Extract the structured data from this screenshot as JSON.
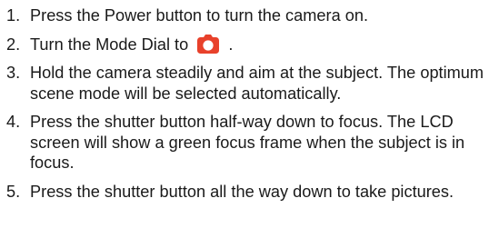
{
  "steps": [
    {
      "number": "1.",
      "text": "Press the Power button to turn the camera on."
    },
    {
      "number": "2.",
      "text_before_icon": "Turn the Mode Dial to",
      "icon": "auto-mode-camera-icon",
      "icon_color": "#e8412b",
      "text_after_icon": "."
    },
    {
      "number": "3.",
      "text": "Hold the camera steadily and aim at the subject. The optimum scene mode will be selected automatically."
    },
    {
      "number": "4.",
      "text": "Press the shutter button half-way down to focus. The LCD screen will show a green focus frame when the subject is in focus."
    },
    {
      "number": "5.",
      "text": "Press the shutter button all the way down to take pictures."
    }
  ]
}
